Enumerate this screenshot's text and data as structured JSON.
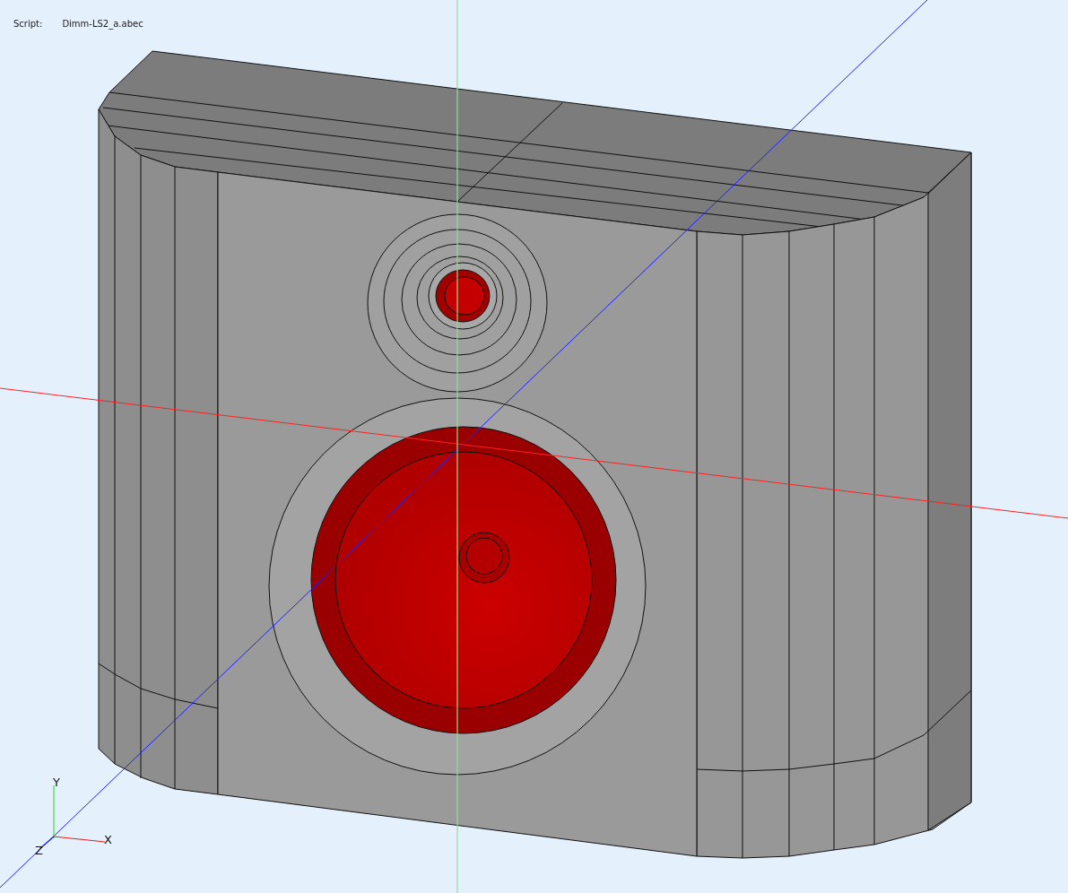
{
  "script_info": {
    "label": "Script:",
    "file": "Dimm-LS2_a.abec"
  },
  "axis_triad": {
    "x_label": "X",
    "y_label": "Y",
    "z_label": "Z"
  }
}
